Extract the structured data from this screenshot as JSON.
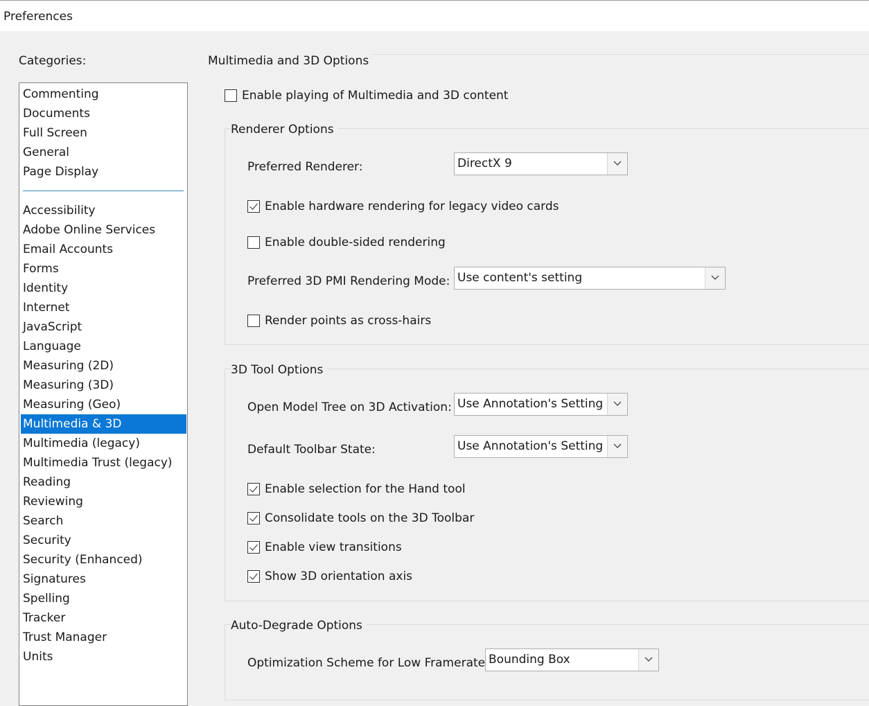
{
  "window": {
    "title": "Preferences"
  },
  "categories": {
    "label": "Categories:",
    "top_items": [
      "Commenting",
      "Documents",
      "Full Screen",
      "General",
      "Page Display"
    ],
    "items": [
      "Accessibility",
      "Adobe Online Services",
      "Email Accounts",
      "Forms",
      "Identity",
      "Internet",
      "JavaScript",
      "Language",
      "Measuring (2D)",
      "Measuring (3D)",
      "Measuring (Geo)",
      "Multimedia & 3D",
      "Multimedia (legacy)",
      "Multimedia Trust (legacy)",
      "Reading",
      "Reviewing",
      "Search",
      "Security",
      "Security (Enhanced)",
      "Signatures",
      "Spelling",
      "Tracker",
      "Trust Manager",
      "Units"
    ],
    "selected": "Multimedia & 3D"
  },
  "main": {
    "group_title": "Multimedia and 3D Options",
    "enable_playing": {
      "label": "Enable playing of Multimedia and 3D content",
      "checked": false
    },
    "renderer": {
      "title": "Renderer Options",
      "preferred_renderer_label": "Preferred Renderer:",
      "preferred_renderer_value": "DirectX 9",
      "hw_rendering": {
        "label": "Enable hardware rendering for legacy video cards",
        "checked": true
      },
      "double_sided": {
        "label": "Enable double-sided rendering",
        "checked": false
      },
      "pmi_mode_label": "Preferred 3D PMI Rendering Mode:",
      "pmi_mode_value": "Use content's setting",
      "cross_hairs": {
        "label": "Render points as cross-hairs",
        "checked": false
      }
    },
    "tool": {
      "title": "3D Tool Options",
      "model_tree_label": "Open Model Tree on 3D Activation:",
      "model_tree_value": "Use Annotation's Setting",
      "toolbar_state_label": "Default Toolbar State:",
      "toolbar_state_value": "Use Annotation's Setting",
      "hand_tool": {
        "label": "Enable selection for the Hand tool",
        "checked": true
      },
      "consolidate": {
        "label": "Consolidate tools on the 3D Toolbar",
        "checked": true
      },
      "view_transitions": {
        "label": "Enable view transitions",
        "checked": true
      },
      "orientation_axis": {
        "label": "Show 3D orientation axis",
        "checked": true
      }
    },
    "degrade": {
      "title": "Auto-Degrade Options",
      "scheme_label": "Optimization Scheme for Low Framerate:",
      "scheme_value": "Bounding Box"
    }
  },
  "colors": {
    "selection": "#0a78d7",
    "background": "#f0f0f0",
    "separator": "#2f8ab8"
  }
}
